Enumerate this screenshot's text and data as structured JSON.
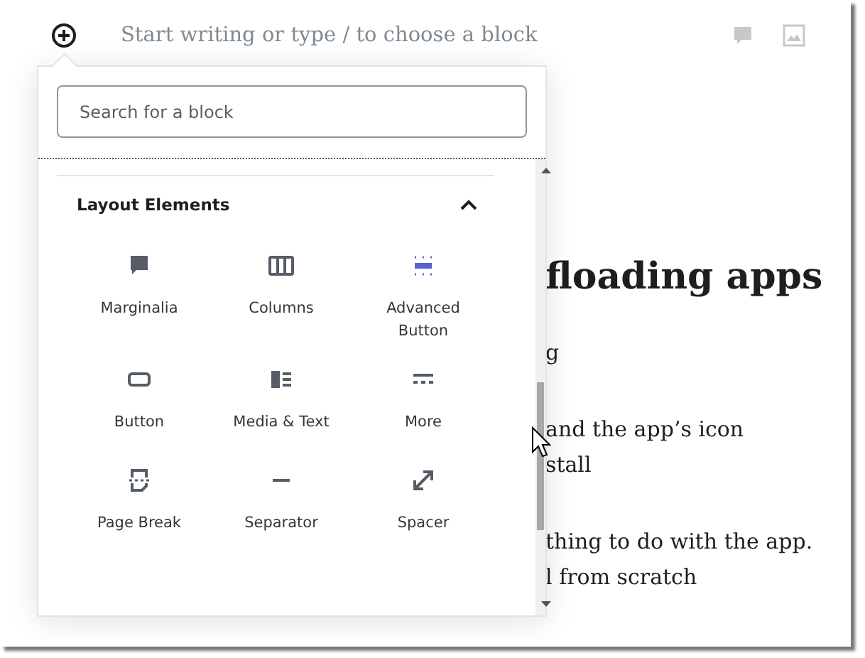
{
  "editor": {
    "placeholder": "Start writing or type / to choose a block",
    "heading": "floading apps",
    "paragraphs": [
      [
        "g"
      ],
      [
        "and the app’s icon",
        "stall"
      ],
      [
        "thing to do with the app.",
        "l from scratch"
      ]
    ]
  },
  "inserter": {
    "search": {
      "placeholder": "Search for a block"
    },
    "section": {
      "title": "Layout Elements",
      "expanded": true
    },
    "blocks": [
      {
        "kind": "marginalia",
        "label": "Marginalia"
      },
      {
        "kind": "columns",
        "label": "Columns"
      },
      {
        "kind": "advanced",
        "label": "Advanced Button"
      },
      {
        "kind": "button",
        "label": "Button"
      },
      {
        "kind": "media",
        "label": "Media & Text"
      },
      {
        "kind": "more",
        "label": "More"
      },
      {
        "kind": "pagebreak",
        "label": "Page Break"
      },
      {
        "kind": "separator",
        "label": "Separator"
      },
      {
        "kind": "spacer",
        "label": "Spacer"
      }
    ]
  }
}
